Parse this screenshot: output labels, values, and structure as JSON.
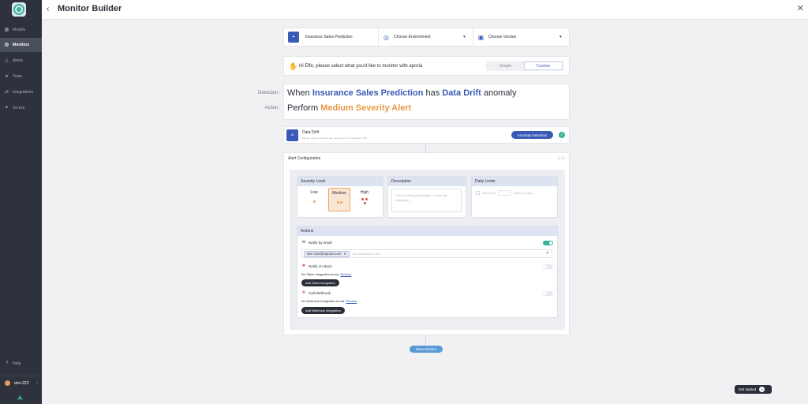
{
  "sidebar": {
    "items": [
      {
        "label": "Models",
        "icon": "models-icon"
      },
      {
        "label": "Monitors",
        "icon": "monitors-icon"
      },
      {
        "label": "Alerts",
        "icon": "alerts-icon"
      },
      {
        "label": "Team",
        "icon": "team-icon"
      },
      {
        "label": "Integrations",
        "icon": "integrations-icon"
      },
      {
        "label": "Go live",
        "icon": "rocket-icon"
      }
    ],
    "help_label": "Help",
    "user_name": "dor+222"
  },
  "header": {
    "title": "Monitor Builder"
  },
  "selector": {
    "model": "Insurance Sales Prediction",
    "environment_placeholder": "Choose Environment",
    "version_placeholder": "Choose Version"
  },
  "greeting": {
    "text": "Hi Effe, please select what you'd like to monitor with aporia",
    "mode_simple": "Simple",
    "mode_custom": "Custom"
  },
  "summary": {
    "detection_label": "Detection:",
    "action_label": "Action:",
    "when": "When",
    "model": "Insurance Sales Prediction",
    "has": "has",
    "monitor_type": "Data Drift",
    "anomaly": "anomaly",
    "perform": "Perform",
    "action": "Medium Severity Alert"
  },
  "monitor_card": {
    "title": "Data Drift",
    "description": "Monitor whether features and raw inputs for a distribution shift",
    "badge": "Anomaly Detection"
  },
  "alert_config": {
    "title": "Alert Configuration",
    "step": "1 / 1",
    "severity": {
      "header": "Severity Level",
      "low": "Low",
      "medium": "Medium",
      "high": "High",
      "selected": "Medium"
    },
    "description": {
      "header": "Description",
      "placeholder": "The monitoring message in a friendly language :)"
    },
    "daily_limits": {
      "header": "Daily Limits",
      "maximum": "Maximum",
      "alerts_per_day": "alerts per day"
    },
    "actions": {
      "header": "Actions",
      "email_label": "Notify by email",
      "email_enabled": true,
      "email_chip": "dor+222@aporia.com",
      "email_placeholder": "john@example.com",
      "slack_label": "Notify on slack",
      "slack_note": "No Slack Integration found.",
      "slack_refresh": "Refresh",
      "slack_button": "Add Slack integration",
      "webhook_label": "Call Webhook",
      "webhook_note": "No Webhook Integration found.",
      "webhook_refresh": "Refresh",
      "webhook_button": "Add Webhook integration"
    }
  },
  "footer": {
    "save_label": "Save Monitor",
    "get_started_label": "Get started",
    "get_started_count": "6"
  },
  "colors": {
    "sidebar_bg": "#2e323d",
    "accent_blue": "#3a5ab7",
    "accent_orange": "#e69a46",
    "success_green": "#38b39b",
    "save_blue": "#5b9bd5"
  }
}
